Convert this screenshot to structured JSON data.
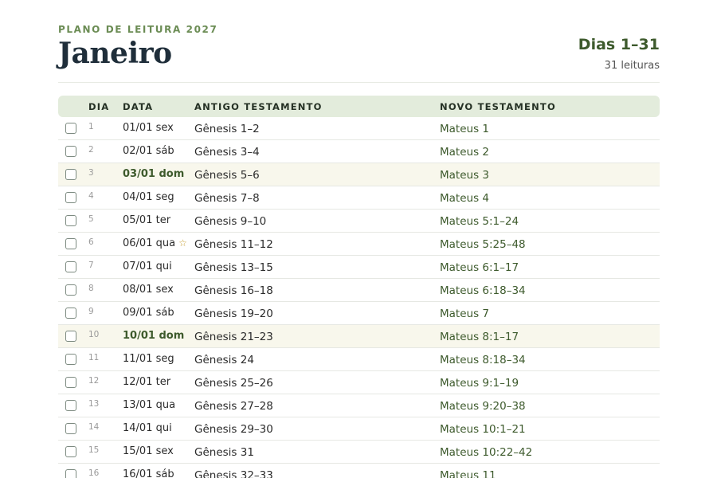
{
  "header": {
    "eyebrow": "PLANO DE LEITURA 2027",
    "title": "Janeiro",
    "range": "Dias 1–31",
    "count": "31 leituras"
  },
  "table": {
    "columns": [
      "DIA",
      "DATA",
      "ANTIGO TESTAMENTO",
      "NOVO TESTAMENTO"
    ],
    "rows": [
      {
        "dia": "1",
        "data": "01/01 sex",
        "at": "Gênesis 1–2",
        "nt": "Mateus 1",
        "sunday": false,
        "star": false
      },
      {
        "dia": "2",
        "data": "02/01 sáb",
        "at": "Gênesis 3–4",
        "nt": "Mateus 2",
        "sunday": false,
        "star": false
      },
      {
        "dia": "3",
        "data": "03/01 dom",
        "at": "Gênesis 5–6",
        "nt": "Mateus 3",
        "sunday": true,
        "star": false
      },
      {
        "dia": "4",
        "data": "04/01 seg",
        "at": "Gênesis 7–8",
        "nt": "Mateus 4",
        "sunday": false,
        "star": false
      },
      {
        "dia": "5",
        "data": "05/01 ter",
        "at": "Gênesis 9–10",
        "nt": "Mateus 5:1–24",
        "sunday": false,
        "star": false
      },
      {
        "dia": "6",
        "data": "06/01 qua",
        "at": "Gênesis 11–12",
        "nt": "Mateus 5:25–48",
        "sunday": false,
        "star": true
      },
      {
        "dia": "7",
        "data": "07/01 qui",
        "at": "Gênesis 13–15",
        "nt": "Mateus 6:1–17",
        "sunday": false,
        "star": false
      },
      {
        "dia": "8",
        "data": "08/01 sex",
        "at": "Gênesis 16–18",
        "nt": "Mateus 6:18–34",
        "sunday": false,
        "star": false
      },
      {
        "dia": "9",
        "data": "09/01 sáb",
        "at": "Gênesis 19–20",
        "nt": "Mateus 7",
        "sunday": false,
        "star": false
      },
      {
        "dia": "10",
        "data": "10/01 dom",
        "at": "Gênesis 21–23",
        "nt": "Mateus 8:1–17",
        "sunday": true,
        "star": false
      },
      {
        "dia": "11",
        "data": "11/01 seg",
        "at": "Gênesis 24",
        "nt": "Mateus 8:18–34",
        "sunday": false,
        "star": false
      },
      {
        "dia": "12",
        "data": "12/01 ter",
        "at": "Gênesis 25–26",
        "nt": "Mateus 9:1–19",
        "sunday": false,
        "star": false
      },
      {
        "dia": "13",
        "data": "13/01 qua",
        "at": "Gênesis 27–28",
        "nt": "Mateus 9:20–38",
        "sunday": false,
        "star": false
      },
      {
        "dia": "14",
        "data": "14/01 qui",
        "at": "Gênesis 29–30",
        "nt": "Mateus 10:1–21",
        "sunday": false,
        "star": false
      },
      {
        "dia": "15",
        "data": "15/01 sex",
        "at": "Gênesis 31",
        "nt": "Mateus 10:22–42",
        "sunday": false,
        "star": false
      },
      {
        "dia": "16",
        "data": "16/01 sáb",
        "at": "Gênesis 32–33",
        "nt": "Mateus 11",
        "sunday": false,
        "star": false
      }
    ]
  },
  "icons": {
    "checkbox": "checkbox-icon",
    "star": "star-icon"
  },
  "colors": {
    "accent_green": "#3d5a2c",
    "eyebrow_green": "#6b8c54",
    "header_bg": "#e3ecdc",
    "sunday_bg": "#f8f7ec",
    "star": "#c9a23a"
  }
}
